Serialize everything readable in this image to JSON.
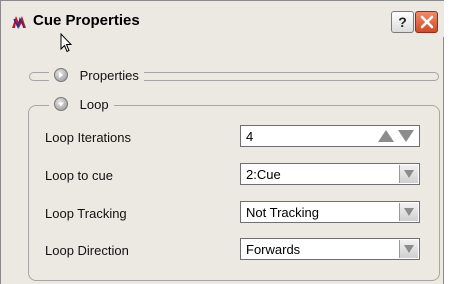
{
  "window": {
    "title": "Cue Properties"
  },
  "titlebar": {
    "help_label": "?"
  },
  "sections": {
    "properties": {
      "label": "Properties"
    },
    "loop": {
      "label": "Loop"
    }
  },
  "loop": {
    "iterations": {
      "label": "Loop Iterations",
      "value": "4"
    },
    "to_cue": {
      "label": "Loop to cue",
      "value": "2:Cue"
    },
    "tracking": {
      "label": "Loop Tracking",
      "value": "Not Tracking"
    },
    "direction": {
      "label": "Loop Direction",
      "value": "Forwards"
    }
  },
  "icons": {
    "app": "app-logo-icon",
    "help": "help-icon",
    "close": "close-icon",
    "collapsed": "collapsed-section-icon",
    "expanded": "expanded-section-icon",
    "spin": "spin-up-down-icon",
    "dropdown": "chevron-down-icon",
    "cursor": "mouse-cursor-icon"
  },
  "colors": {
    "close_button": "#d04a26",
    "window_bg": "#ece9e2"
  }
}
